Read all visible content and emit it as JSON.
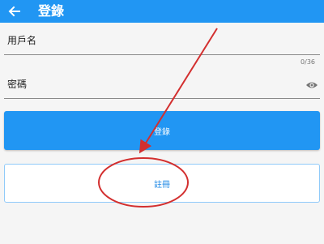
{
  "appbar": {
    "title": "登錄",
    "back_icon": "arrow-left-icon",
    "color": "#2196f3"
  },
  "form": {
    "username_label": "用戶名",
    "password_label": "密碼",
    "password_counter": "0/36",
    "visibility_icon": "eye-icon"
  },
  "buttons": {
    "login_label": "登錄",
    "register_label": "註冊"
  },
  "annotation": {
    "color": "#d32f2f"
  }
}
